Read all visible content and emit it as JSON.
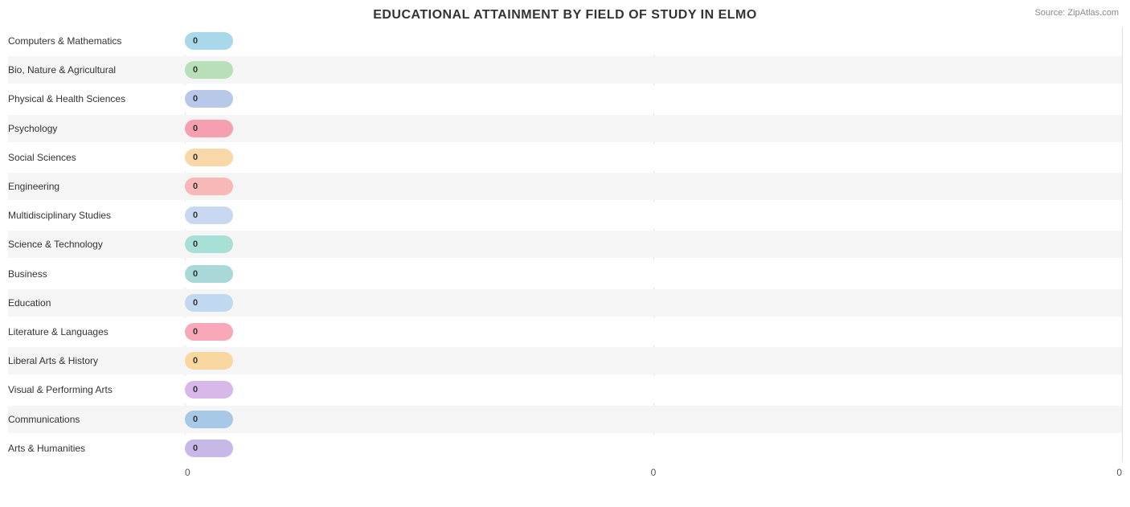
{
  "title": "EDUCATIONAL ATTAINMENT BY FIELD OF STUDY IN ELMO",
  "source": "Source: ZipAtlas.com",
  "bars": [
    {
      "label": "Computers & Mathematics",
      "value": 0,
      "color": "#a8d8ea"
    },
    {
      "label": "Bio, Nature & Agricultural",
      "value": 0,
      "color": "#b8e0b8"
    },
    {
      "label": "Physical & Health Sciences",
      "value": 0,
      "color": "#b8c8e8"
    },
    {
      "label": "Psychology",
      "value": 0,
      "color": "#f4a0b0"
    },
    {
      "label": "Social Sciences",
      "value": 0,
      "color": "#f8d8a8"
    },
    {
      "label": "Engineering",
      "value": 0,
      "color": "#f8b8b8"
    },
    {
      "label": "Multidisciplinary Studies",
      "value": 0,
      "color": "#c8d8f0"
    },
    {
      "label": "Science & Technology",
      "value": 0,
      "color": "#a8e0d8"
    },
    {
      "label": "Business",
      "value": 0,
      "color": "#a8d8d8"
    },
    {
      "label": "Education",
      "value": 0,
      "color": "#c0d8f0"
    },
    {
      "label": "Literature & Languages",
      "value": 0,
      "color": "#f8a8b8"
    },
    {
      "label": "Liberal Arts & History",
      "value": 0,
      "color": "#f8d8a0"
    },
    {
      "label": "Visual & Performing Arts",
      "value": 0,
      "color": "#d8b8e8"
    },
    {
      "label": "Communications",
      "value": 0,
      "color": "#a8c8e8"
    },
    {
      "label": "Arts & Humanities",
      "value": 0,
      "color": "#c8b8e8"
    }
  ],
  "x_axis_labels": [
    "0",
    "0",
    "0"
  ],
  "bar_min_width": 60
}
